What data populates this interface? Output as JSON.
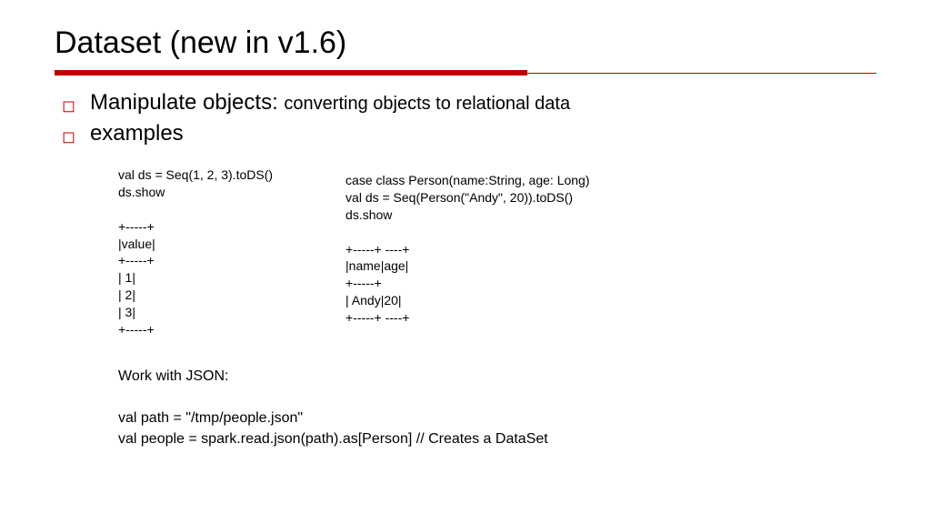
{
  "title": "Dataset (new in v1.6)",
  "bullets": [
    {
      "strong": "Manipulate objects: ",
      "sub": "converting objects to relational data"
    },
    {
      "strong": "examples",
      "sub": ""
    }
  ],
  "left_code": "val ds = Seq(1, 2, 3).toDS()\nds.show\n\n+-----+\n|value|\n+-----+\n| 1|\n| 2|\n| 3|\n+-----+",
  "right_code": "case class Person(name:String, age: Long)\nval ds = Seq(Person(\"Andy\", 20)).toDS()\nds.show\n\n+-----+ ----+\n|name|age|\n+-----+\n| Andy|20|\n+-----+ ----+",
  "json_block": "Work with JSON:\n\nval path = \"/tmp/people.json\"\nval people = spark.read.json(path).as[Person] // Creates a DataSet"
}
